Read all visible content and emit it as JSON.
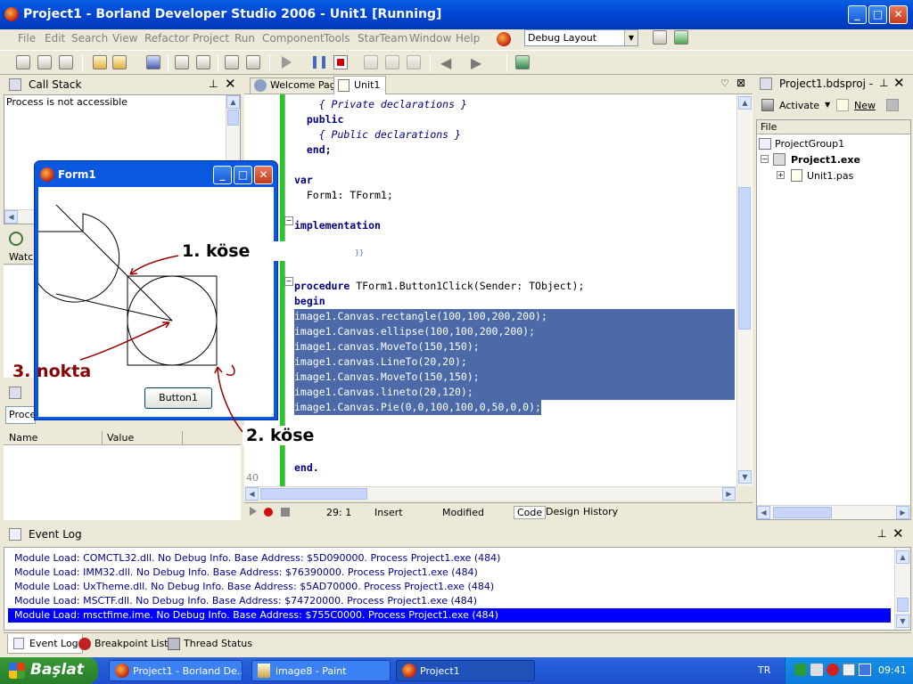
{
  "window": {
    "title": "Project1 - Borland Developer Studio 2006 - Unit1 [Running]"
  },
  "menu": [
    "File",
    "Edit",
    "Search",
    "View",
    "Refactor",
    "Project",
    "Run",
    "Component",
    "Tools",
    "StarTeam",
    "Window",
    "Help"
  ],
  "layout_combo": {
    "value": "Debug Layout"
  },
  "call_stack": {
    "title": "Call Stack",
    "message": "Process is not accessible"
  },
  "watch_tab": "Watch",
  "locals": {
    "combo_value": "Proce",
    "columns": [
      "Name",
      "Value"
    ]
  },
  "editor_tabs": [
    "Welcome Page",
    "Unit1"
  ],
  "code_lines": [
    {
      "text": "    { Private declarations }",
      "style": "cm",
      "indent": 0
    },
    {
      "text": "  public",
      "style": "kw"
    },
    {
      "text": "    { Public declarations }",
      "style": "cm"
    },
    {
      "text": "  end;",
      "style": "kw"
    },
    {
      "text": "",
      "style": ""
    },
    {
      "text": "var",
      "style": "kw"
    },
    {
      "text": "  Form1: TForm1;",
      "style": ""
    },
    {
      "text": "",
      "style": ""
    },
    {
      "text": "implementation",
      "style": "kw"
    },
    {
      "text": "",
      "style": ""
    },
    {
      "text": "",
      "style": ""
    },
    {
      "text": "",
      "style": ""
    },
    {
      "text": "procedure TForm1.Button1Click(Sender: TObject);",
      "style": "proc"
    },
    {
      "text": "begin",
      "style": "kw"
    },
    {
      "text": "image1.Canvas.rectangle(100,100,200,200);",
      "style": "sel"
    },
    {
      "text": "image1.Canvas.ellipse(100,100,200,200);",
      "style": "sel"
    },
    {
      "text": "image1.canvas.MoveTo(150,150);",
      "style": "sel"
    },
    {
      "text": "image1.canvas.LineTo(20,20);",
      "style": "sel"
    },
    {
      "text": "image1.Canvas.MoveTo(150,150);",
      "style": "sel"
    },
    {
      "text": "image1.Canvas.lineto(20,120);",
      "style": "sel"
    },
    {
      "text": "image1.Canvas.Pie(0,0,100,100,0,50,0,0);",
      "style": "sel"
    },
    {
      "text": "",
      "style": ""
    },
    {
      "text": "",
      "style": ""
    },
    {
      "text": "end.",
      "style": "kw"
    }
  ],
  "line_number": "40",
  "status": {
    "position": "29:  1",
    "mode": "Insert",
    "state": "Modified"
  },
  "view_tabs": [
    "Code",
    "Design",
    "History"
  ],
  "project_manager": {
    "title": "Project1.bdsproj - ...",
    "activate": "Activate",
    "new": "New",
    "column": "File",
    "group": "ProjectGroup1",
    "project": "Project1.exe",
    "unit": "Unit1.pas"
  },
  "form1": {
    "title": "Form1",
    "button": "Button1"
  },
  "annotations": {
    "corner1": "1. köse",
    "point3": "3. nokta",
    "corner2": "2. köse"
  },
  "event_log": {
    "title": "Event Log",
    "lines": [
      "Module Load: COMCTL32.dll. No Debug Info. Base Address: $5D090000. Process Project1.exe (484)",
      "Module Load: IMM32.dll. No Debug Info. Base Address: $76390000. Process Project1.exe (484)",
      "Module Load: UxTheme.dll. No Debug Info. Base Address: $5AD70000. Process Project1.exe (484)",
      "Module Load: MSCTF.dll. No Debug Info. Base Address: $74720000. Process Project1.exe (484)",
      "Module Load: msctfime.ime. No Debug Info. Base Address: $755C0000. Process Project1.exe (484)"
    ],
    "selected_index": 4
  },
  "bottom_tabs": [
    "Event Log",
    "Breakpoint List",
    "Thread Status"
  ],
  "taskbar": {
    "start": "Başlat",
    "items": [
      "Project1 - Borland De...",
      "image8 - Paint",
      "Project1"
    ],
    "lang": "TR",
    "clock": "09:41"
  },
  "colors": {
    "title_blue": "#0046d5",
    "selection": "#4d6aa8",
    "log_selected": "#0000ff"
  }
}
